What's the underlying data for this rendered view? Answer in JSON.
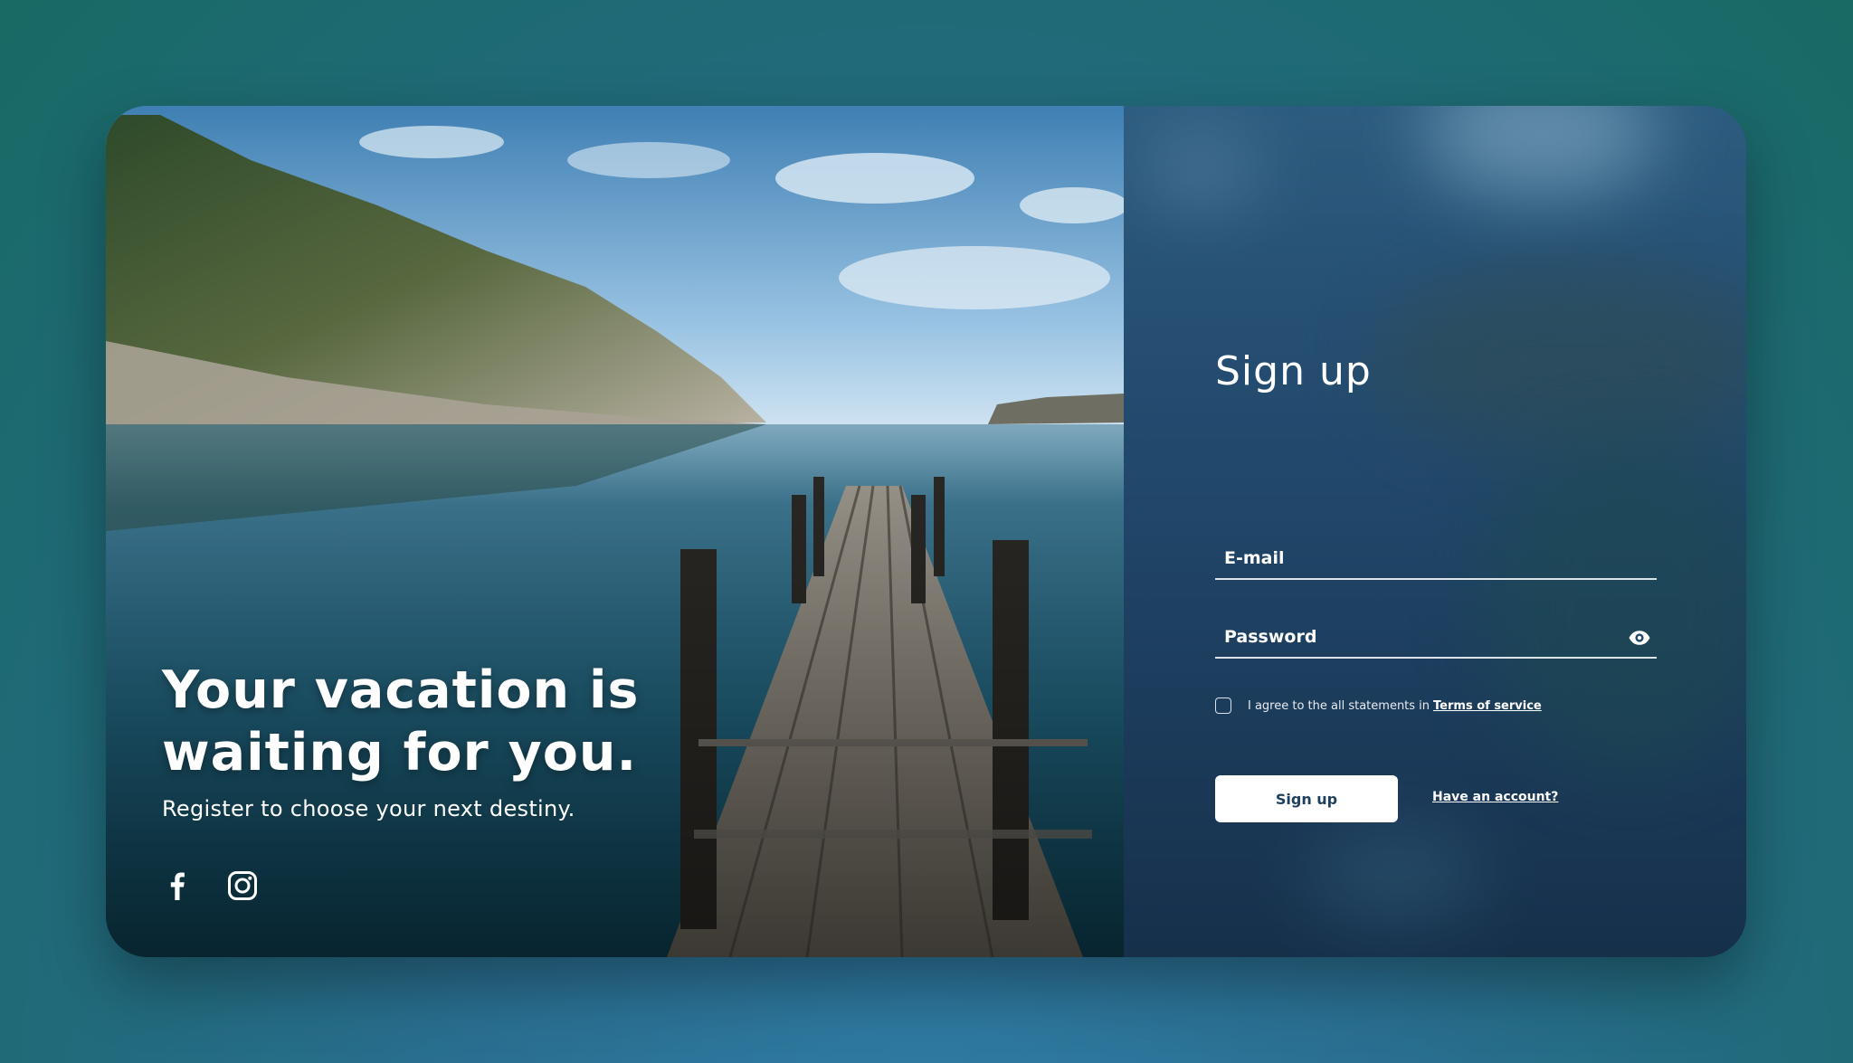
{
  "hero": {
    "title_line1": "Your vacation is",
    "title_line2": "waiting for you.",
    "subtitle": "Register to choose your next destiny.",
    "social": [
      {
        "icon": "facebook-icon"
      },
      {
        "icon": "instagram-icon"
      }
    ]
  },
  "form": {
    "title": "Sign up",
    "email_placeholder": "E-mail",
    "password_placeholder": "Password",
    "password_toggle_icon": "eye-icon",
    "terms_text": "I agree to the all statements in",
    "terms_link": "Terms of service",
    "submit_label": "Sign up",
    "account_link": "Have an account?"
  },
  "colors": {
    "background": "#1f6f7a",
    "panel": "#21476a",
    "button_text": "#1f3f5f",
    "button_bg": "#ffffff"
  }
}
